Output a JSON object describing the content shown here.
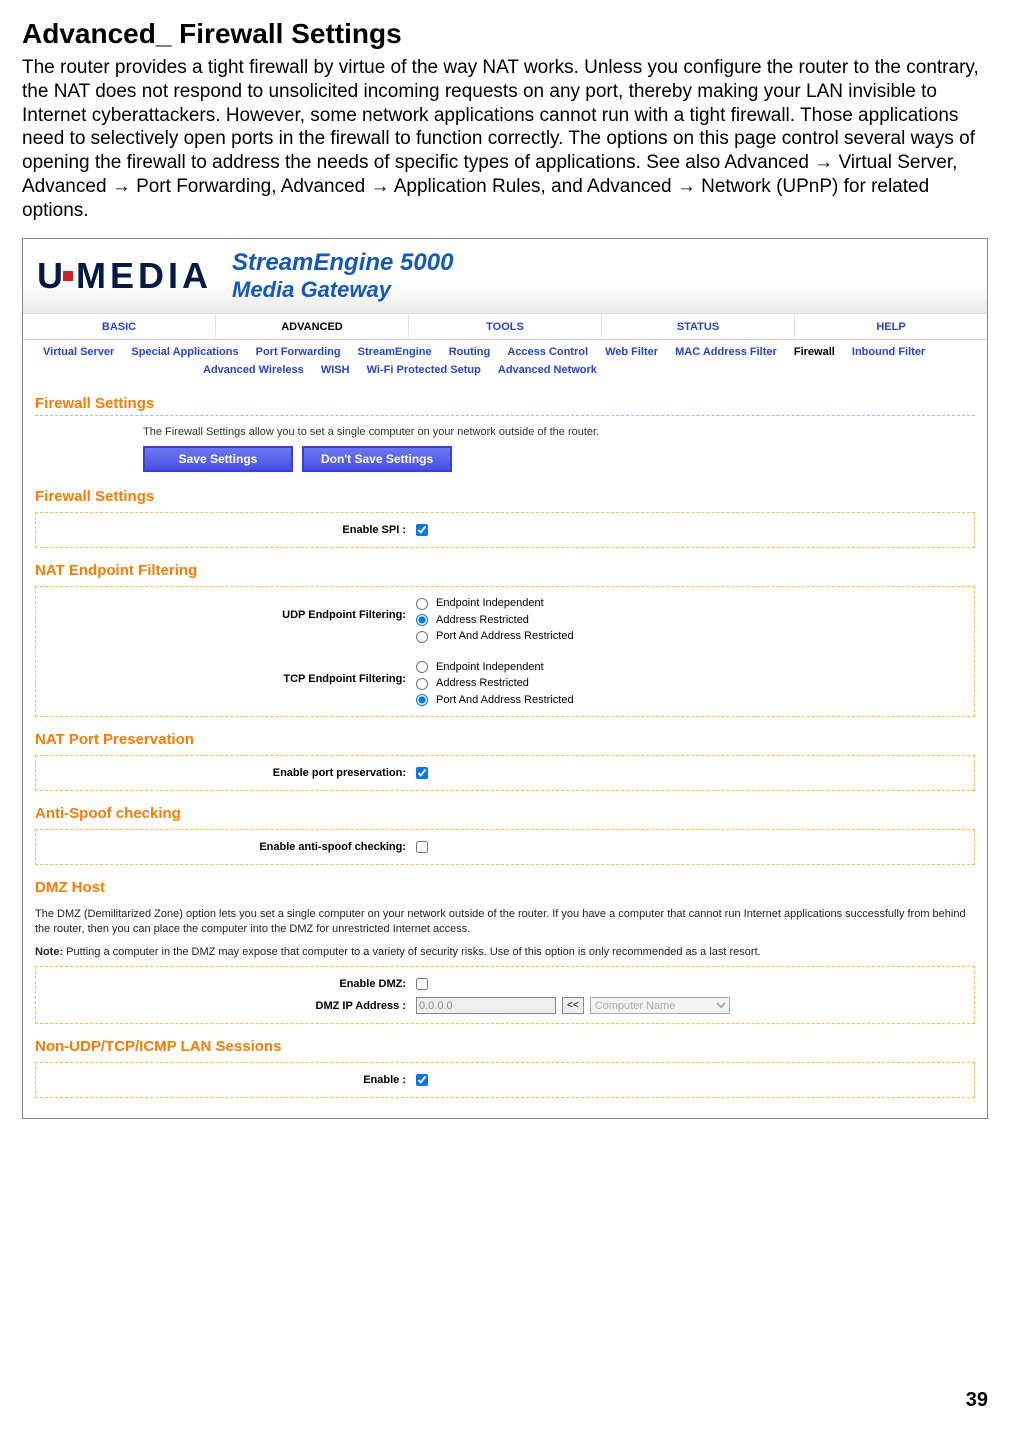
{
  "doc": {
    "title": "Advanced_ Firewall Settings",
    "intro": "The router provides a tight firewall by virtue of the way NAT works. Unless you configure the router to the contrary, the NAT does not respond to unsolicited incoming requests on any port, thereby making your LAN invisible to Internet cyberattackers. However, some network applications cannot run with a tight firewall. Those applications need to selectively open ports in the firewall to function correctly. The options on this page control several ways of opening the firewall to address the needs of specific types of applications. See also Advanced → Virtual Server, Advanced → Port Forwarding, Advanced → Application Rules, and Advanced → Network (UPnP) for related options.",
    "page_number": "39"
  },
  "header": {
    "brand_u": "U",
    "brand_media": "MEDIA",
    "product_line1": "StreamEngine 5000",
    "product_line2": "Media Gateway"
  },
  "topnav": {
    "items": [
      "BASIC",
      "ADVANCED",
      "TOOLS",
      "STATUS",
      "HELP"
    ]
  },
  "subnav": {
    "row1": [
      "Virtual Server",
      "Special Applications",
      "Port Forwarding",
      "StreamEngine",
      "Routing",
      "Access Control",
      "Web Filter",
      "MAC Address Filter",
      "Firewall",
      "Inbound Filter"
    ],
    "row2": [
      "Advanced Wireless",
      "WISH",
      "Wi-Fi Protected Setup",
      "Advanced Network"
    ]
  },
  "sections": {
    "page_title": "Firewall Settings",
    "intro_text": "The Firewall Settings allow you to set a single computer on your network outside of the router.",
    "btn_save": "Save Settings",
    "btn_dont": "Don't Save Settings",
    "fw_settings_title": "Firewall Settings",
    "enable_spi_label": "Enable SPI :",
    "nat_filtering_title": "NAT Endpoint Filtering",
    "udp_label": "UDP Endpoint Filtering:",
    "tcp_label": "TCP Endpoint Filtering:",
    "opt_ei": "Endpoint Independent",
    "opt_ar": "Address Restricted",
    "opt_par": "Port And Address Restricted",
    "nat_port_title": "NAT Port Preservation",
    "port_pres_label": "Enable port preservation:",
    "antispoof_title": "Anti-Spoof checking",
    "antispoof_label": "Enable anti-spoof checking:",
    "dmz_title": "DMZ Host",
    "dmz_para1": "The DMZ (Demilitarized Zone) option lets you set a single computer on your network outside of the router. If you have a computer that cannot run Internet applications successfully from behind the router, then you can place the computer into the DMZ for unrestricted Internet access.",
    "dmz_note_label": "Note:",
    "dmz_note": " Putting a computer in the DMZ may expose that computer to a variety of security risks. Use of this option is only recommended as a last resort.",
    "enable_dmz_label": "Enable DMZ:",
    "dmz_ip_label": "DMZ IP Address :",
    "dmz_ip_value": "0.0.0.0",
    "copy_btn": "<<",
    "comp_dropdown": "Computer Name",
    "nonudp_title": "Non-UDP/TCP/ICMP LAN Sessions",
    "nonudp_enable_label": "Enable :"
  }
}
